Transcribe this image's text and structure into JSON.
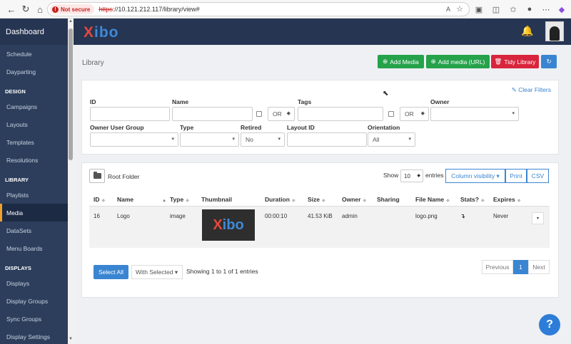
{
  "browser": {
    "not_secure": "Not secure",
    "url_scheme": "https",
    "url_rest": "://10.121.212.117/library/view#"
  },
  "sidebar": {
    "brand": "Dashboard",
    "items": [
      {
        "label": "Schedule",
        "type": "item"
      },
      {
        "label": "Dayparting",
        "type": "item"
      },
      {
        "label": "DESIGN",
        "type": "section"
      },
      {
        "label": "Campaigns",
        "type": "item"
      },
      {
        "label": "Layouts",
        "type": "item"
      },
      {
        "label": "Templates",
        "type": "item"
      },
      {
        "label": "Resolutions",
        "type": "item"
      },
      {
        "label": "LIBRARY",
        "type": "section"
      },
      {
        "label": "Playlists",
        "type": "item"
      },
      {
        "label": "Media",
        "type": "item",
        "active": true
      },
      {
        "label": "DataSets",
        "type": "item"
      },
      {
        "label": "Menu Boards",
        "type": "item"
      },
      {
        "label": "DISPLAYS",
        "type": "section"
      },
      {
        "label": "Displays",
        "type": "item"
      },
      {
        "label": "Display Groups",
        "type": "item"
      },
      {
        "label": "Sync Groups",
        "type": "item"
      },
      {
        "label": "Display Settings",
        "type": "item"
      }
    ]
  },
  "header": {
    "logo": {
      "x": "X",
      "rest": "ibo"
    }
  },
  "page": {
    "title": "Library",
    "buttons": {
      "add_media": "Add Media",
      "add_media_url": "Add media (URL)",
      "tidy_library": "Tidy Library"
    }
  },
  "filters": {
    "clear": "Clear Filters",
    "id_label": "ID",
    "name_label": "Name",
    "name_op": "OR",
    "tags_label": "Tags",
    "tags_op": "OR",
    "owner_label": "Owner",
    "owner_group_label": "Owner User Group",
    "type_label": "Type",
    "retired_label": "Retired",
    "retired_value": "No",
    "layout_id_label": "Layout ID",
    "orientation_label": "Orientation",
    "orientation_value": "All"
  },
  "table": {
    "root_folder": "Root Folder",
    "show": "Show",
    "page_size": "10",
    "entries": "entries",
    "column_visibility": "Column visibility",
    "print": "Print",
    "csv": "CSV",
    "columns": [
      "ID",
      "Name",
      "Type",
      "Thumbnail",
      "Duration",
      "Size",
      "Owner",
      "Sharing",
      "File Name",
      "Stats?",
      "Expires"
    ],
    "rows": [
      {
        "id": "16",
        "name": "Logo",
        "type": "image",
        "thumbnail_x": "X",
        "thumbnail_rest": "ibo",
        "duration": "00:00:10",
        "size": "41.53 KiB",
        "owner": "admin",
        "sharing": "",
        "file_name": "logo.png",
        "stats": "↴",
        "expires": "Never"
      }
    ],
    "select_all": "Select All",
    "with_selected": "With Selected",
    "showing": "Showing 1 to 1 of 1 entries",
    "pagination": {
      "previous": "Previous",
      "current": "1",
      "next": "Next"
    }
  },
  "help": "?"
}
